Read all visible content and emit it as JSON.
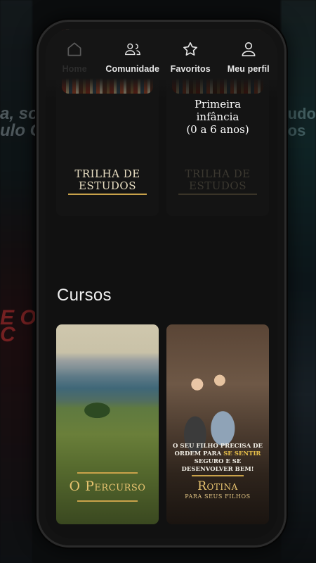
{
  "background": {
    "left_text": "a, so\nulo C",
    "right_text": "udo\nos",
    "red_text": "E OF\nC"
  },
  "nav": {
    "items": [
      {
        "label": "Home",
        "icon": "home-icon",
        "active": true
      },
      {
        "label": "Comunidade",
        "icon": "users-icon",
        "active": false
      },
      {
        "label": "Favoritos",
        "icon": "star-icon",
        "active": false
      },
      {
        "label": "Meu perfil",
        "icon": "user-icon",
        "active": false
      }
    ]
  },
  "top_cards": [
    {
      "title_line1": "TRILHA DE",
      "title_line2": "ESTUDOS",
      "overlay": ""
    },
    {
      "title_line1": "TRILHA DE",
      "title_line2": "ESTUDOS",
      "overlay": "Primeira\ninfância\n(0 a 6 anos)"
    }
  ],
  "section": {
    "title": "Cursos"
  },
  "courses": [
    {
      "title": "O Percurso"
    },
    {
      "text_before": "O seu filho precisa de ordem para ",
      "text_highlight": "se sentir",
      "text_after": " seguro e se desenvolver bem!",
      "title": "Rotina",
      "subtitle": "PARA SEUS FILHOS"
    }
  ],
  "colors": {
    "accent_gold": "#c9a24a",
    "background": "#111111",
    "nav_text": "#e6e6e6"
  }
}
